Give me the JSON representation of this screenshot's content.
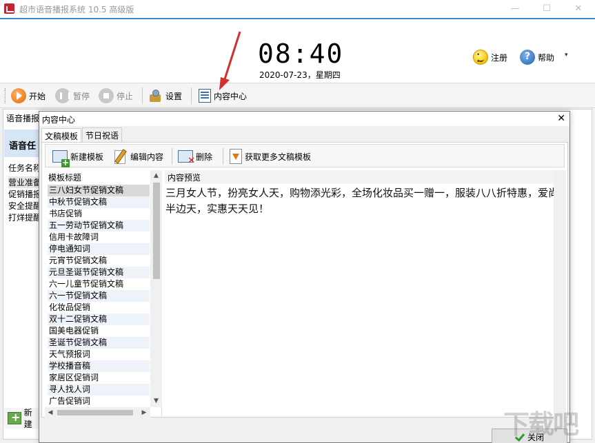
{
  "app": {
    "title": "超市语音播报系统 10.5 高级版",
    "win_min": "—",
    "win_max": "☐",
    "win_close": "✕"
  },
  "header": {
    "time": "08:40",
    "date": "2020-07-23，星期四",
    "register_label": "注册",
    "help_label": "帮助",
    "dropdown_glyph": "▾"
  },
  "toolbar": {
    "start_label": "开始",
    "pause_label": "暂停",
    "stop_label": "停止",
    "settings_label": "设置",
    "content_center_label": "内容中心"
  },
  "background": {
    "tab_label": "语音播报",
    "section_title": "语音任",
    "column_header": "任务名称",
    "rows": [
      "营业准备",
      "促销播报",
      "安全提醒",
      "打烊提醒"
    ],
    "add_label": "新建"
  },
  "dialog": {
    "title": "内容中心",
    "close_glyph": "✕",
    "tabs": [
      "文稿模板",
      "节日祝语"
    ],
    "toolbar": {
      "new_label": "新建模板",
      "edit_label": "编辑内容",
      "delete_label": "删除",
      "more_label": "获取更多文稿模板"
    },
    "list_header": "模板标题",
    "templates": [
      "三八妇女节促销文稿",
      "中秋节促销文稿",
      "书店促销",
      "五一劳动节促销文稿",
      "信用卡故障词",
      "停电通知词",
      "元宵节促销文稿",
      "元旦圣诞节促销文稿",
      "六一儿童节促销文稿",
      "六一节促销文稿",
      "化妆品促销",
      "双十二促销文稿",
      "国美电器促销",
      "圣诞节促销文稿",
      "天气预报词",
      "学校播音稿",
      "家居区促销词",
      "寻人找人词",
      "广告促销词"
    ],
    "selected_index": 0,
    "preview_header": "内容预览",
    "preview_text": "三月女人节，扮亮女人天，购物添光彩，全场化妆品买一赠一，服装八八折特惠，爱尚半边天，实惠天天见！",
    "close_button_label": "关闭"
  },
  "watermark": "下载吧",
  "colors": {
    "accent": "#2f8cd6",
    "arrow": "#d32f2f",
    "selection": "#d9d9d9",
    "alt_row": "#eef3f9"
  }
}
